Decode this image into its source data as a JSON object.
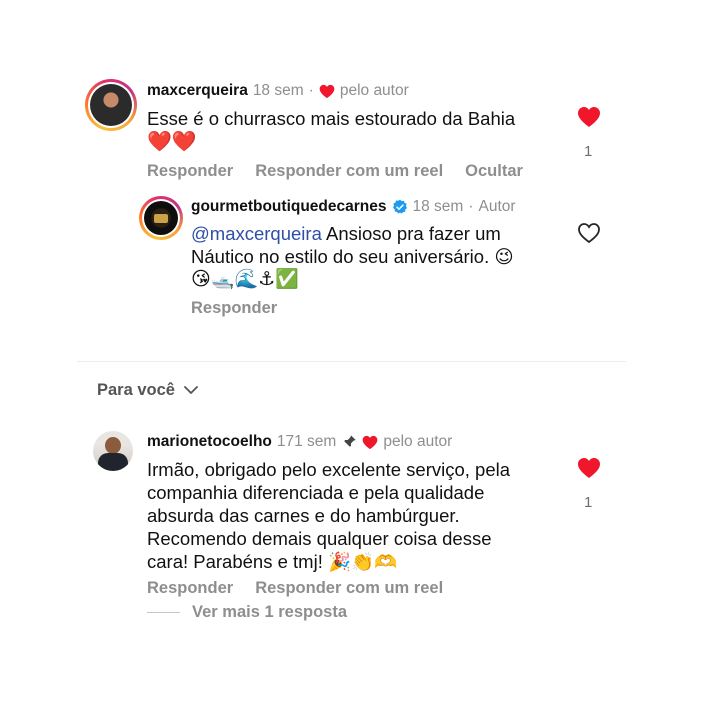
{
  "comments": [
    {
      "username": "maxcerqueira",
      "time": "18 sem",
      "sep": "·",
      "badge_liked": "pelo autor",
      "text": "Esse é o churrasco mais estourado da Bahia",
      "emojis": "❤️❤️",
      "like_count": "1",
      "actions": [
        "Responder",
        "Responder com um reel",
        "Ocultar"
      ],
      "avatar_icon": "user-photo-avatar"
    },
    {
      "username": "gourmetboutiquedecarnes",
      "time": "18 sem",
      "sep": "·",
      "author_tag": "Autor",
      "mention": "@maxcerqueira",
      "text_line1": " Ansioso pra fazer um",
      "text_line2": "Náutico no estilo do seu aniversário. 😉",
      "emoji_line": "😘🛥️🌊⚓✅",
      "actions": [
        "Responder"
      ],
      "avatar_icon": "gourmet-logo-avatar",
      "verified_icon": "verified-badge-icon"
    },
    {
      "username": "marionetocoelho",
      "time": "171 sem",
      "badge_liked": "pelo autor",
      "lines": [
        "Irmão, obrigado pelo excelente serviço, pela",
        "companhia diferenciada e pela qualidade",
        "absurda das carnes e do hambúrguer.",
        "Recomendo demais qualquer coisa desse",
        "cara! Parabéns e tmj! 🎉👏🫶"
      ],
      "like_count": "1",
      "actions": [
        "Responder",
        "Responder com um reel"
      ],
      "view_more": "Ver mais 1 resposta",
      "avatar_icon": "user-photo-avatar",
      "pin_icon": "pin-icon"
    }
  ],
  "section_label": "Para você",
  "colors": {
    "heart": "#f0162b",
    "verified": "#1d9bf0",
    "muted": "#8e8e8e",
    "mention": "#2f4ea8"
  }
}
